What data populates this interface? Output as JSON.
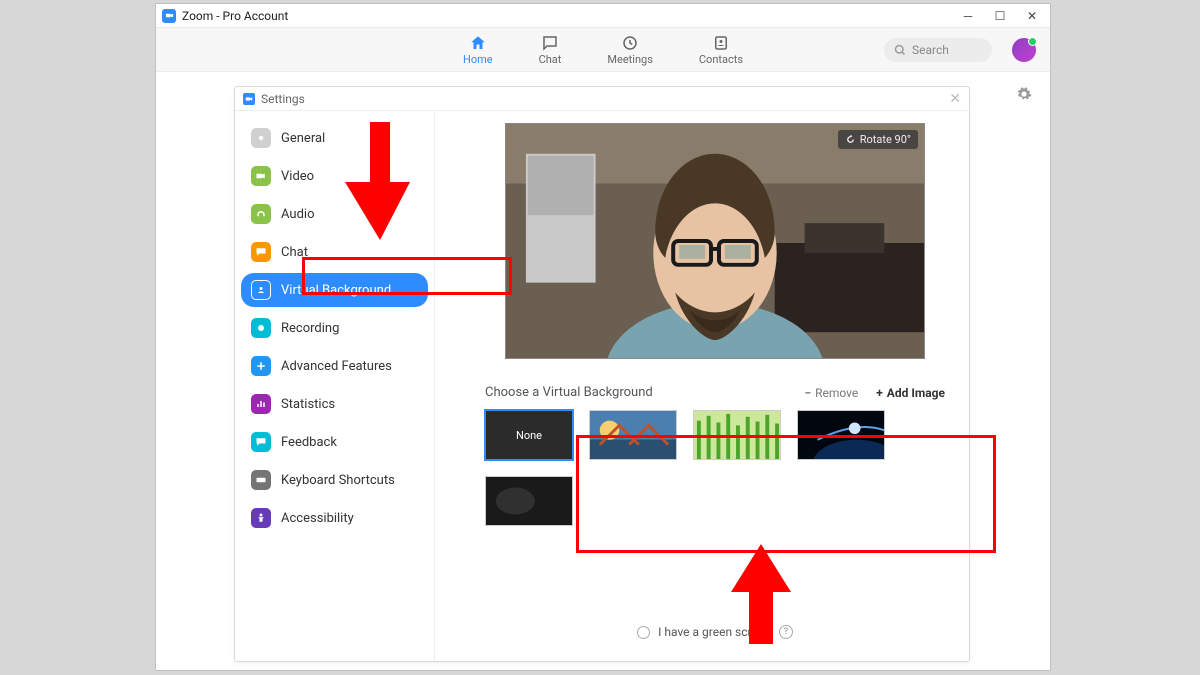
{
  "window": {
    "title": "Zoom - Pro Account"
  },
  "topnav": {
    "tabs": [
      {
        "label": "Home",
        "active": true
      },
      {
        "label": "Chat"
      },
      {
        "label": "Meetings"
      },
      {
        "label": "Contacts"
      }
    ],
    "search_placeholder": "Search"
  },
  "settings": {
    "title": "Settings",
    "sidebar": {
      "items": [
        {
          "label": "General"
        },
        {
          "label": "Video"
        },
        {
          "label": "Audio"
        },
        {
          "label": "Chat"
        },
        {
          "label": "Virtual Background",
          "active": true
        },
        {
          "label": "Recording"
        },
        {
          "label": "Advanced Features"
        },
        {
          "label": "Statistics"
        },
        {
          "label": "Feedback"
        },
        {
          "label": "Keyboard Shortcuts"
        },
        {
          "label": "Accessibility"
        }
      ]
    },
    "preview": {
      "rotate_label": "Rotate 90°"
    },
    "choose_label": "Choose a Virtual Background",
    "remove_label": "Remove",
    "add_label": "Add Image",
    "thumbs": {
      "none_label": "None"
    },
    "greenscreen_label": "I have a green screen"
  }
}
